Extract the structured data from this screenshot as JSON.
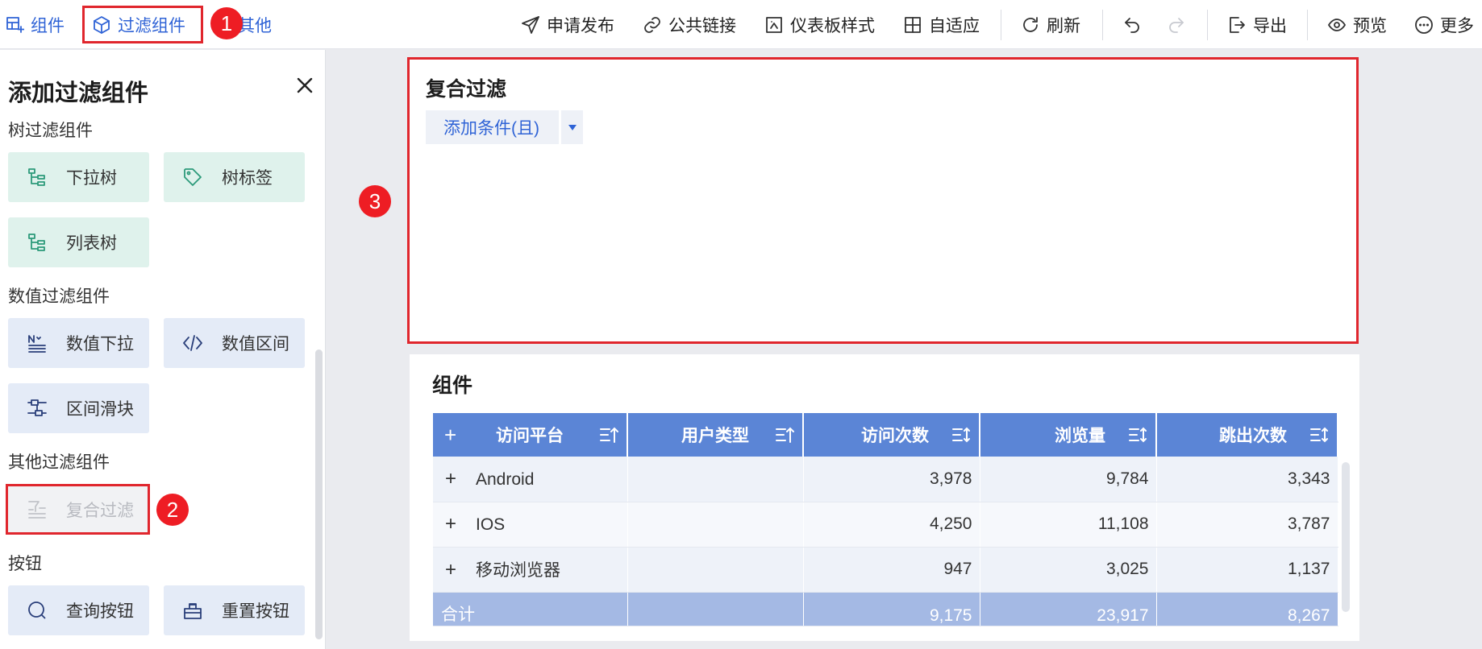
{
  "toolbar": {
    "left": [
      {
        "label": "组件",
        "icon": "add-component-icon"
      },
      {
        "label": "过滤组件",
        "icon": "filter-cube-icon"
      },
      {
        "label": "其他",
        "icon": ""
      }
    ],
    "right": [
      {
        "label": "申请发布",
        "icon": "send-icon"
      },
      {
        "label": "公共链接",
        "icon": "link-icon"
      },
      {
        "label": "仪表板样式",
        "icon": "style-icon"
      },
      {
        "label": "自适应",
        "icon": "grid-icon"
      },
      {
        "label": "刷新",
        "icon": "refresh-icon"
      },
      {
        "label": "导出",
        "icon": "export-icon"
      },
      {
        "label": "预览",
        "icon": "preview-icon"
      },
      {
        "label": "更多",
        "icon": "more-icon"
      }
    ],
    "undo_icon": "undo-icon",
    "redo_icon": "redo-icon"
  },
  "badges": [
    "1",
    "2",
    "3"
  ],
  "panel": {
    "title": "添加过滤组件",
    "sections": [
      {
        "title": "树过滤组件",
        "items": [
          "下拉树",
          "树标签",
          "列表树"
        ]
      },
      {
        "title": "数值过滤组件",
        "items": [
          "数值下拉",
          "数值区间",
          "区间滑块"
        ]
      },
      {
        "title": "其他过滤组件",
        "items": [
          "复合过滤"
        ]
      },
      {
        "title": "按钮",
        "items": [
          "查询按钮",
          "重置按钮"
        ]
      }
    ]
  },
  "filter_card": {
    "title": "复合过滤",
    "add_condition": "添加条件(且)"
  },
  "table_card": {
    "title": "组件",
    "columns": [
      "访问平台",
      "用户类型",
      "访问次数",
      "浏览量",
      "跳出次数"
    ],
    "rows": [
      {
        "platform": "Android",
        "user_type": "",
        "visits": "3,978",
        "views": "9,784",
        "bounces": "3,343"
      },
      {
        "platform": "IOS",
        "user_type": "",
        "visits": "4,250",
        "views": "11,108",
        "bounces": "3,787"
      },
      {
        "platform": "移动浏览器",
        "user_type": "",
        "visits": "947",
        "views": "3,025",
        "bounces": "1,137"
      }
    ],
    "total": {
      "label": "合计",
      "visits": "9,175",
      "views": "23,917",
      "bounces": "8,267"
    }
  },
  "colors": {
    "accent": "#2f63d6",
    "highlight": "#e0262d",
    "header": "#5b85d6",
    "tree_card_bg": "#dff2ec",
    "numeric_card_bg": "#e4ebf7"
  }
}
